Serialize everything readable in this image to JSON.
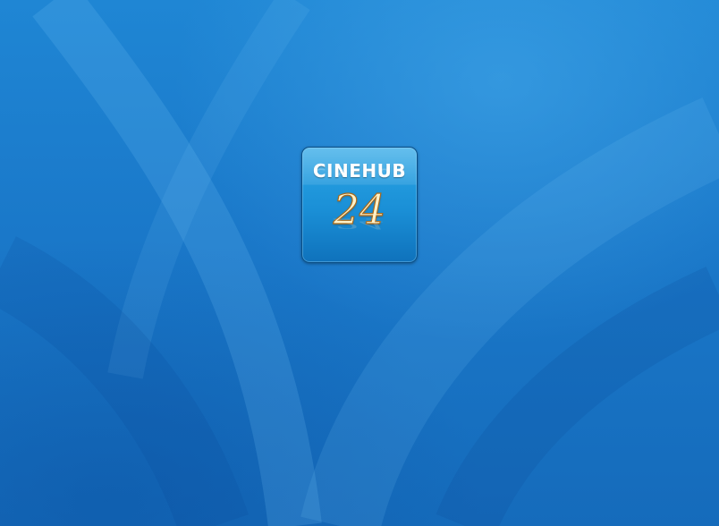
{
  "desktop": {
    "background_color": "#1a78c9",
    "background_highlight": "#46aaeb"
  },
  "app_icon": {
    "brand": "CINEHUB",
    "number": "24",
    "accent_color": "#1a8fd6",
    "number_color": "#fff2c8"
  }
}
